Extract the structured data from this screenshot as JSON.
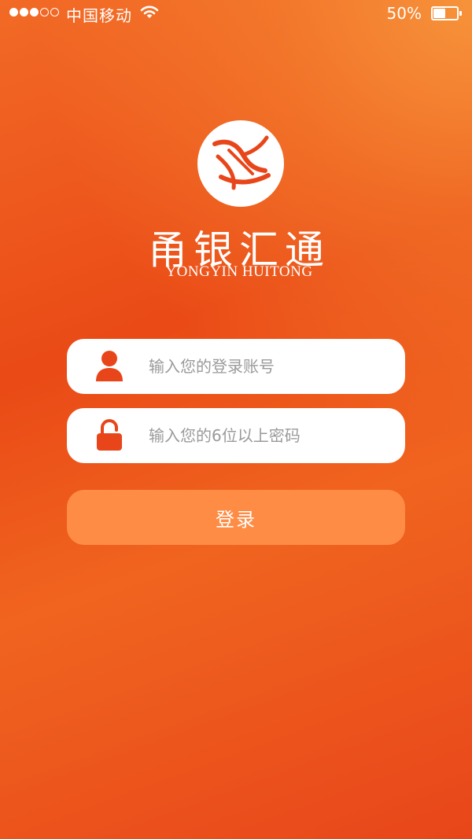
{
  "status_bar": {
    "signal_dots_filled": 3,
    "signal_dots_total": 5,
    "carrier": "中国移动",
    "battery_percent": "50%",
    "battery_level": 0.5,
    "wifi_icon": "wifi-icon"
  },
  "brand": {
    "logo_icon": "brand-logo-icon",
    "name_cn": "甬银汇通",
    "name_en": "YONGYIN HUITONG"
  },
  "login_form": {
    "account_icon": "user-icon",
    "account_placeholder": "输入您的登录账号",
    "account_value": "",
    "password_icon": "lock-icon",
    "password_placeholder": "输入您的6位以上密码",
    "password_value": "",
    "submit_label": "登录"
  },
  "colors": {
    "background_primary": "#ea4a16",
    "background_highlight": "#f5923a",
    "icon_accent": "#e8461a",
    "button_background": "#ff8c45",
    "placeholder_text": "#9a9a9a"
  }
}
